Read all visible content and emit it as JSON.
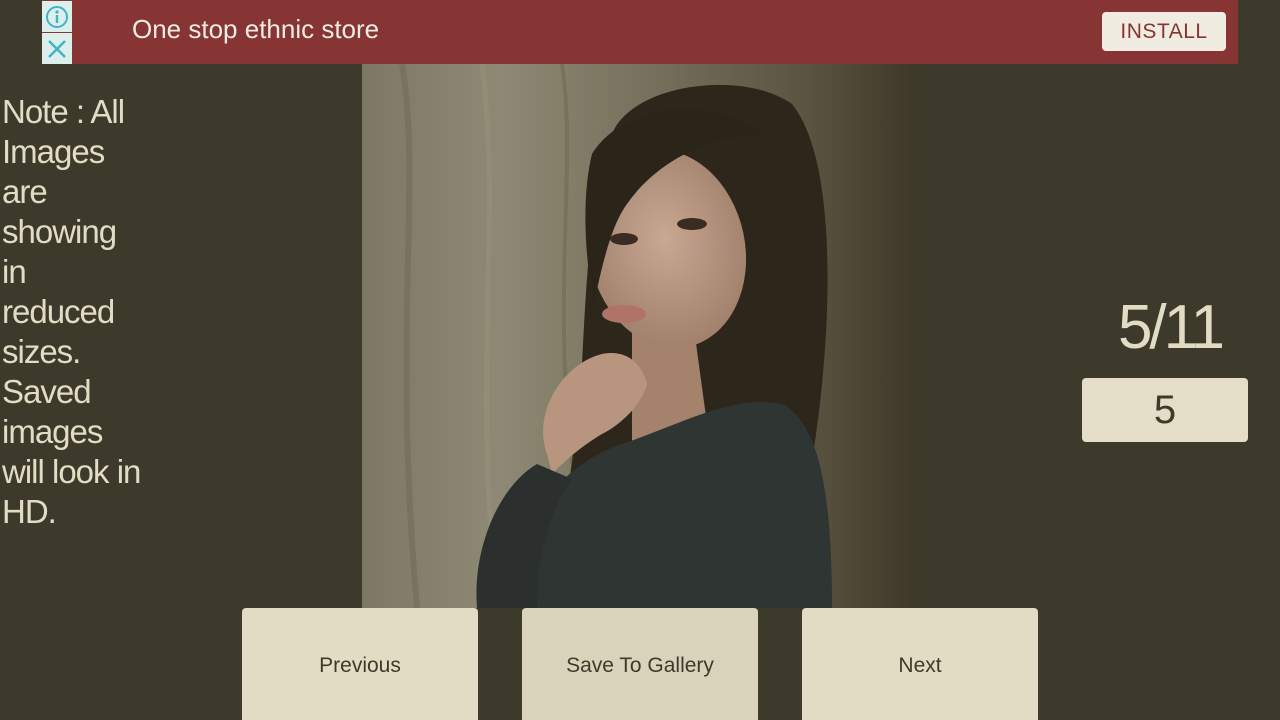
{
  "ad": {
    "text": "One stop ethnic store",
    "install_label": "INSTALL",
    "info_icon": "info-icon",
    "close_icon": "close-icon",
    "background_color": "#873434"
  },
  "note": {
    "text": "Note : All Images are showing in reduced sizes. Saved images will look in HD."
  },
  "counter": {
    "text": "5/11",
    "current": 5,
    "total": 11
  },
  "page_input": {
    "value": "5"
  },
  "buttons": {
    "previous": "Previous",
    "save": "Save To Gallery",
    "next": "Next"
  },
  "colors": {
    "background": "#3e3a2b",
    "button": "#e2dcc5",
    "text_light": "#e2dcc4"
  }
}
